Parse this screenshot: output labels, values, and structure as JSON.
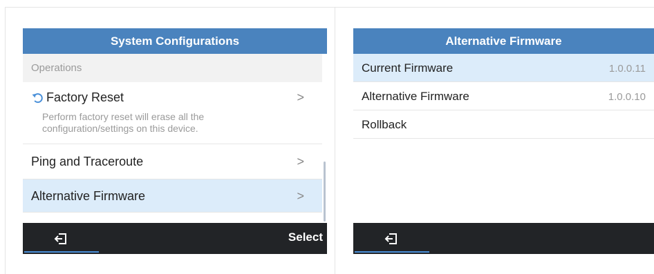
{
  "left_screen": {
    "title": "System Configurations",
    "section_header": "Operations",
    "items": [
      {
        "label": "Factory Reset",
        "icon": "reset-icon",
        "description": "Perform factory reset will erase all the configuration/settings on this device.",
        "chevron": ">"
      },
      {
        "label": "Ping and Traceroute",
        "chevron": ">"
      },
      {
        "label": "Alternative Firmware",
        "chevron": ">",
        "selected": true
      }
    ],
    "softkeys": {
      "back_icon": "exit-icon",
      "select_label": "Select"
    }
  },
  "right_screen": {
    "title": "Alternative Firmware",
    "items": [
      {
        "label": "Current Firmware",
        "value": "1.0.0.11",
        "selected": true
      },
      {
        "label": "Alternative Firmware",
        "value": "1.0.0.10"
      },
      {
        "label": "Rollback",
        "value": ""
      }
    ],
    "softkeys": {
      "back_icon": "exit-icon"
    }
  },
  "colors": {
    "titlebar": "#4a83be",
    "selected_row": "#dcecfa",
    "softbar": "#222427",
    "accent_underline": "#4a90d9"
  }
}
